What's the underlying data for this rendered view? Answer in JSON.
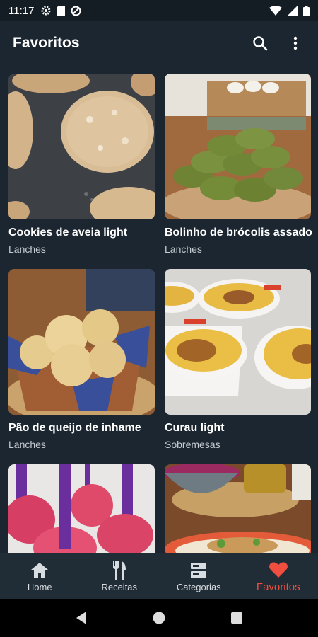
{
  "status_bar": {
    "time": "11:17"
  },
  "app_bar": {
    "title": "Favoritos"
  },
  "recipes": [
    {
      "name": "Cookies de aveia light",
      "category": "Lanches"
    },
    {
      "name": "Bolinho de brócolis assado",
      "category": "Lanches"
    },
    {
      "name": "Pão de queijo de inhame",
      "category": "Lanches"
    },
    {
      "name": "Curau light",
      "category": "Sobremesas"
    }
  ],
  "bottom_nav": {
    "items": [
      {
        "label": "Home",
        "icon": "home-icon"
      },
      {
        "label": "Receitas",
        "icon": "cutlery-icon"
      },
      {
        "label": "Categorias",
        "icon": "categories-icon"
      },
      {
        "label": "Favoritos",
        "icon": "heart-icon"
      }
    ],
    "active": "Favoritos"
  },
  "colors": {
    "background": "#1b2630",
    "accent": "#f04e3e",
    "nav_background": "#202c36"
  }
}
